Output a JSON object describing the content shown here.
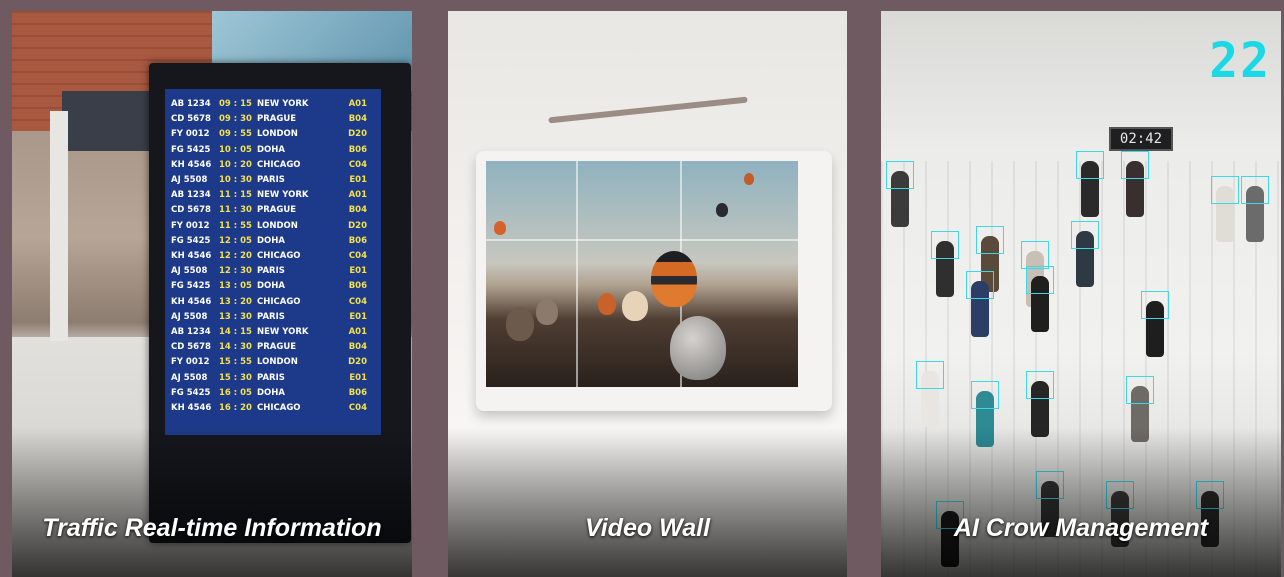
{
  "panels": [
    {
      "caption": "Traffic Real-time Information",
      "flights": [
        {
          "code": "AB 1234",
          "time": "09 : 15",
          "city": "NEW YORK",
          "gate": "A01"
        },
        {
          "code": "CD 5678",
          "time": "09 : 30",
          "city": "PRAGUE",
          "gate": "B04"
        },
        {
          "code": "FY 0012",
          "time": "09 : 55",
          "city": "LONDON",
          "gate": "D20"
        },
        {
          "code": "FG 5425",
          "time": "10 : 05",
          "city": "DOHA",
          "gate": "B06"
        },
        {
          "code": "KH 4546",
          "time": "10 : 20",
          "city": "CHICAGO",
          "gate": "C04"
        },
        {
          "code": "AJ 5508",
          "time": "10 : 30",
          "city": "PARIS",
          "gate": "E01"
        },
        {
          "code": "AB 1234",
          "time": "11 : 15",
          "city": "NEW YORK",
          "gate": "A01"
        },
        {
          "code": "CD 5678",
          "time": "11 : 30",
          "city": "PRAGUE",
          "gate": "B04"
        },
        {
          "code": "FY 0012",
          "time": "11 : 55",
          "city": "LONDON",
          "gate": "D20"
        },
        {
          "code": "FG 5425",
          "time": "12 : 05",
          "city": "DOHA",
          "gate": "B06"
        },
        {
          "code": "KH 4546",
          "time": "12 : 20",
          "city": "CHICAGO",
          "gate": "C04"
        },
        {
          "code": "AJ 5508",
          "time": "12 : 30",
          "city": "PARIS",
          "gate": "E01"
        },
        {
          "code": "FG 5425",
          "time": "13 : 05",
          "city": "DOHA",
          "gate": "B06"
        },
        {
          "code": "KH 4546",
          "time": "13 : 20",
          "city": "CHICAGO",
          "gate": "C04"
        },
        {
          "code": "AJ 5508",
          "time": "13 : 30",
          "city": "PARIS",
          "gate": "E01"
        },
        {
          "code": "AB 1234",
          "time": "14 : 15",
          "city": "NEW YORK",
          "gate": "A01"
        },
        {
          "code": "CD 5678",
          "time": "14 : 30",
          "city": "PRAGUE",
          "gate": "B04"
        },
        {
          "code": "FY 0012",
          "time": "15 : 55",
          "city": "LONDON",
          "gate": "D20"
        },
        {
          "code": "AJ 5508",
          "time": "15 : 30",
          "city": "PARIS",
          "gate": "E01"
        },
        {
          "code": "FG 5425",
          "time": "16 : 05",
          "city": "DOHA",
          "gate": "B06"
        },
        {
          "code": "KH 4546",
          "time": "16 : 20",
          "city": "CHICAGO",
          "gate": "C04"
        }
      ]
    },
    {
      "caption": "Video Wall"
    },
    {
      "caption": "AI Crow Management",
      "counter": "22",
      "clock": "02:42"
    }
  ],
  "colors": {
    "background": "#6e5a60",
    "board": "#1d3a8a",
    "board_highlight": "#f4e04d",
    "detection": "#3fd6e6"
  }
}
